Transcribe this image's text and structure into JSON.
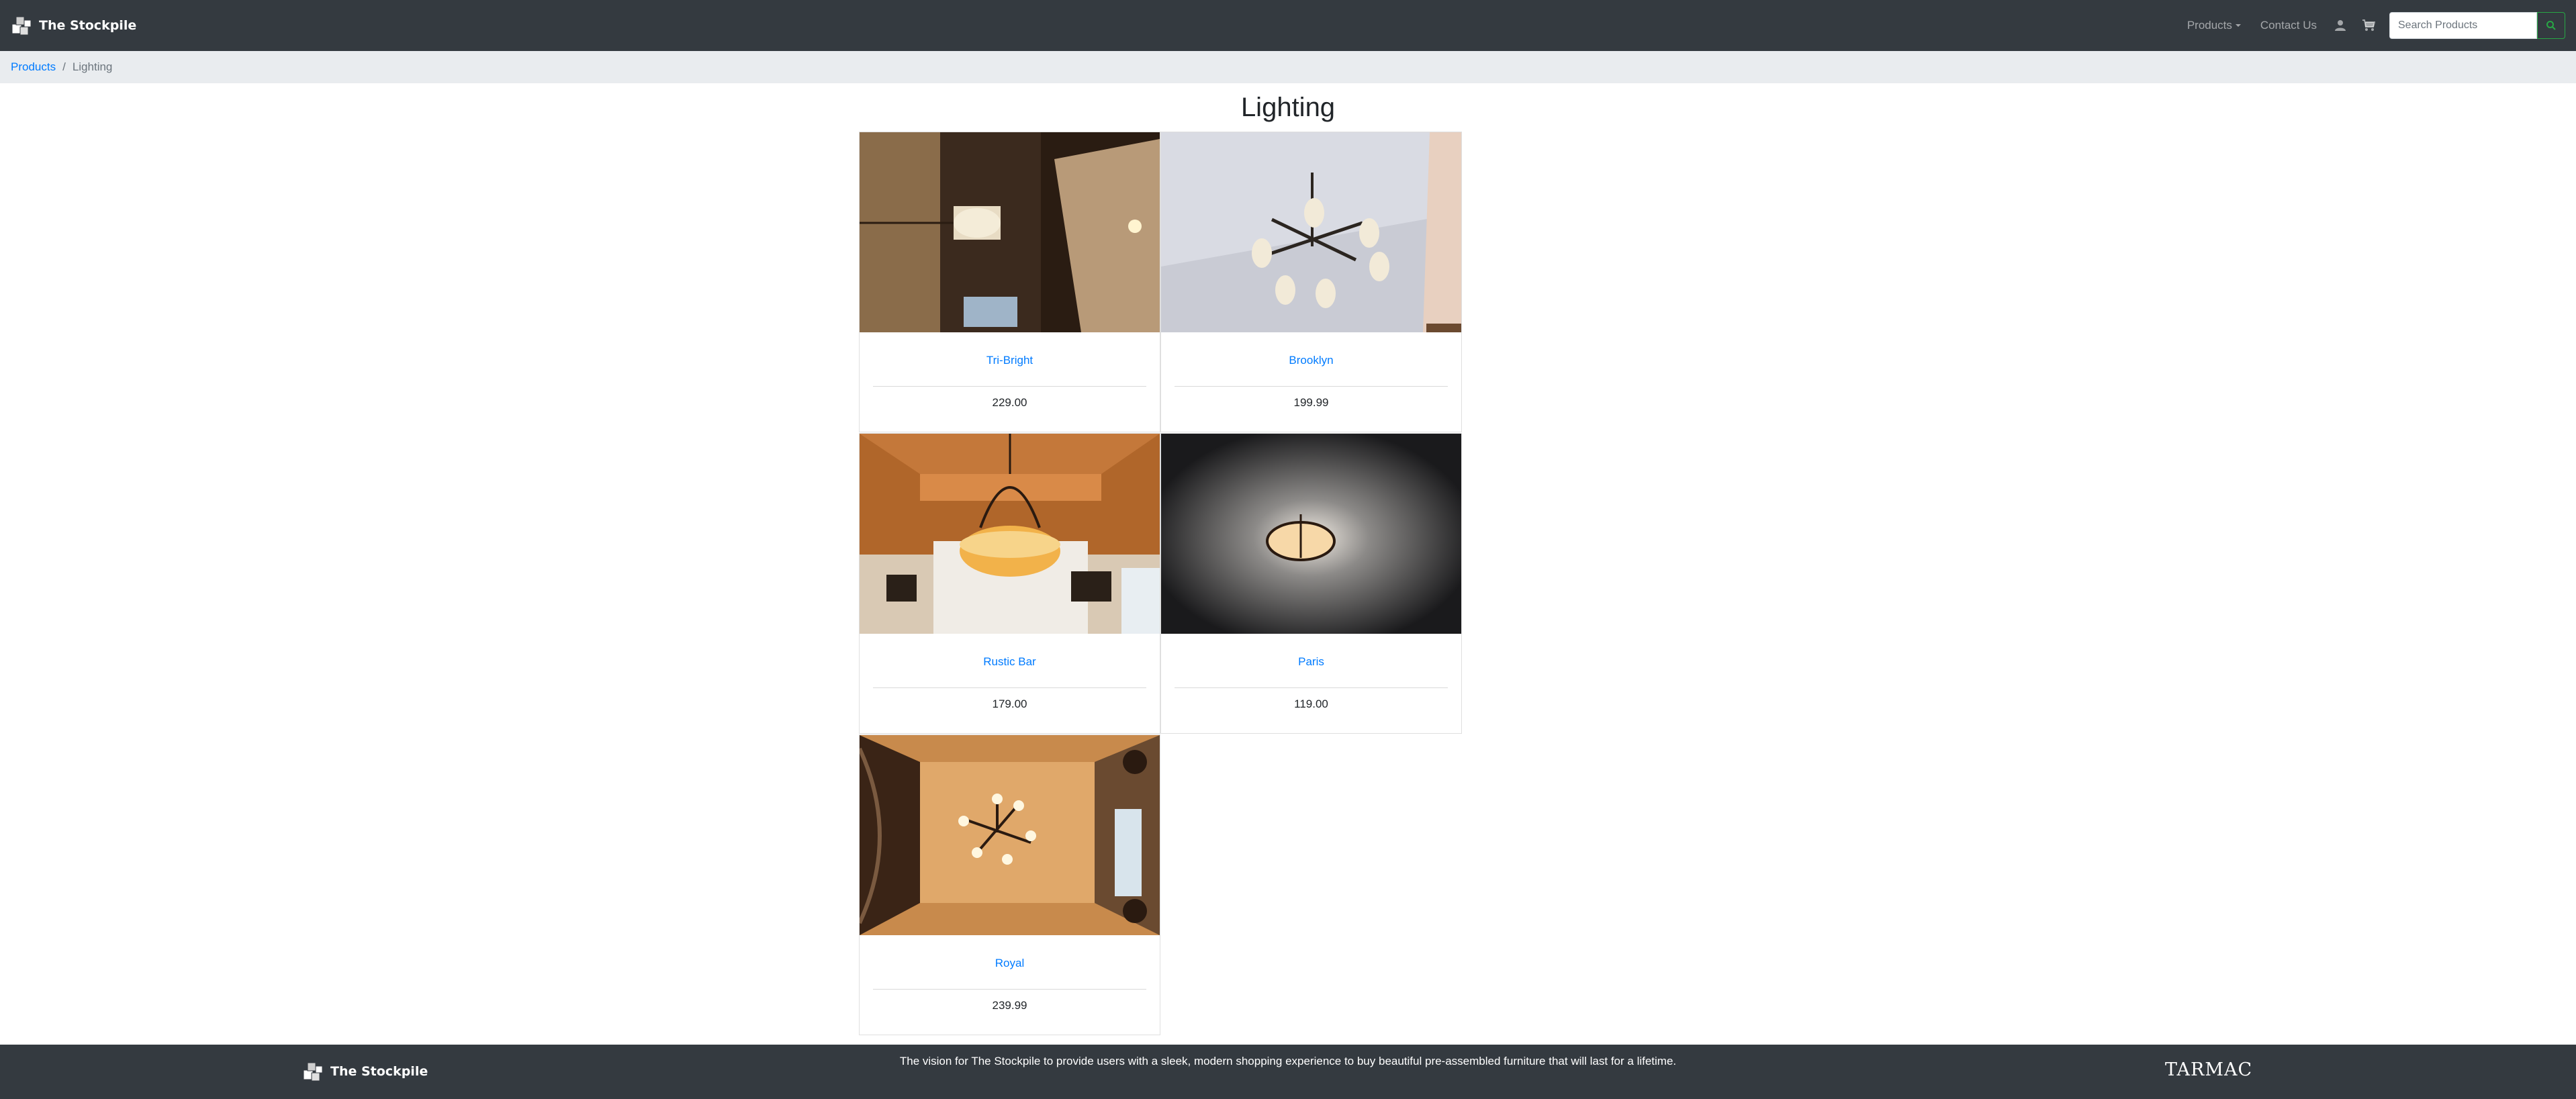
{
  "navbar": {
    "brand": "The Stockpile",
    "products_label": "Products",
    "contact_label": "Contact Us",
    "search_placeholder": "Search Products"
  },
  "breadcrumb": {
    "root": "Products",
    "separator": "/",
    "current": "Lighting"
  },
  "page": {
    "title": "Lighting"
  },
  "products": [
    {
      "name": "Tri-Bright",
      "price": "229.00"
    },
    {
      "name": "Brooklyn",
      "price": "199.99"
    },
    {
      "name": "Rustic Bar",
      "price": "179.00"
    },
    {
      "name": "Paris",
      "price": "119.00"
    },
    {
      "name": "Royal",
      "price": "239.99"
    }
  ],
  "footer": {
    "brand": "The Stockpile",
    "vision": "The vision for The Stockpile to provide users with a sleek, modern shopping experience to buy beautiful pre-assembled furniture that will last for a lifetime.",
    "partner": "TARMAC"
  },
  "colors": {
    "navbar_bg": "#343a40",
    "breadcrumb_bg": "#e9ecef",
    "link": "#007bff",
    "search_button_border": "#28a745"
  },
  "icons": {
    "brand_logo": "stockpile-logo-icon",
    "dropdown": "caret-down-icon",
    "user": "user-icon",
    "cart": "cart-icon",
    "search": "search-icon"
  }
}
